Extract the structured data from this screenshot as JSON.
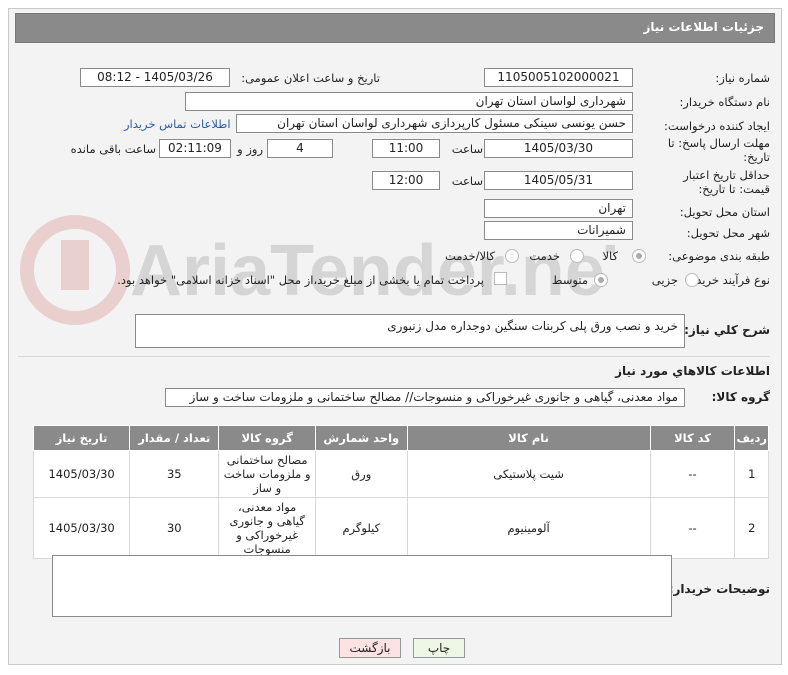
{
  "header": {
    "title": "جزئیات اطلاعات نیاز"
  },
  "form": {
    "need_number_label": "شماره نیاز:",
    "need_number": "1105005102000021",
    "announce_label": "تاریخ و ساعت اعلان عمومی:",
    "announce_value": "1405/03/26 - 08:12",
    "buyer_org_label": "نام دستگاه خریدار:",
    "buyer_org": "شهرداری لواسان استان تهران",
    "creator_label": "ایجاد کننده درخواست:",
    "creator": "حسن یونسی سینکی مسئول کارپردازی شهرداری لواسان استان تهران",
    "contact_link": "اطلاعات تماس خریدار",
    "reply_deadline_label": "مهلت ارسال پاسخ: تا تاریخ:",
    "reply_date": "1405/03/30",
    "time_label": "ساعت",
    "reply_time": "11:00",
    "days_value": "4",
    "days_label": "روز و",
    "remaining_time": "02:11:09",
    "remaining_label": "ساعت باقی مانده",
    "min_price_label": "حداقل تاریخ اعتبار قیمت: تا تاریخ:",
    "price_date": "1405/05/31",
    "price_time": "12:00",
    "province_label": "استان محل تحویل:",
    "province": "تهران",
    "city_label": "شهر محل تحویل:",
    "city": "شمیرانات",
    "category_label": "طبقه بندی موضوعی:",
    "category_options": [
      "کالا",
      "خدمت",
      "کالا/خدمت"
    ],
    "process_label": "نوع فرآیند خرید :",
    "process_options": [
      "جزیی",
      "متوسط"
    ],
    "payment_note": "پرداخت تمام یا بخشی از مبلغ خرید،از محل \"اسناد خزانه اسلامی\" خواهد بود."
  },
  "summary": {
    "label": "شرح کلي نياز:",
    "text": "خرید و نصب ورق پلی کربنات سنگین دوجداره مدل زنبوری"
  },
  "goods": {
    "section_title": "اطلاعات کالاهاي مورد نياز",
    "group_label": "گروه کالا:",
    "group_value": "مواد معدنی، گیاهی و جانوری غیرخوراکی و منسوجات// مصالح ساختمانی و ملزومات ساخت و ساز",
    "columns": [
      "ردیف",
      "کد کالا",
      "نام کالا",
      "واحد شمارش",
      "گروه کالا",
      "تعداد / مقدار",
      "تاریخ نیاز"
    ],
    "rows": [
      {
        "row": "1",
        "code": "--",
        "name": "شیت پلاستیکی",
        "unit": "ورق",
        "group": "مصالح ساختمانی و ملزومات ساخت و ساز",
        "qty": "35",
        "date": "1405/03/30"
      },
      {
        "row": "2",
        "code": "--",
        "name": "آلومینیوم",
        "unit": "کیلوگرم",
        "group": "مواد معدنی، گیاهی و جانوری غیرخوراکی و منسوجات",
        "qty": "30",
        "date": "1405/03/30"
      }
    ]
  },
  "buyer_notes": {
    "label": "توضیحات خریدار:"
  },
  "buttons": {
    "print": "چاپ",
    "back": "بازگشت"
  },
  "watermark": {
    "text": "AriaTender.neT"
  }
}
